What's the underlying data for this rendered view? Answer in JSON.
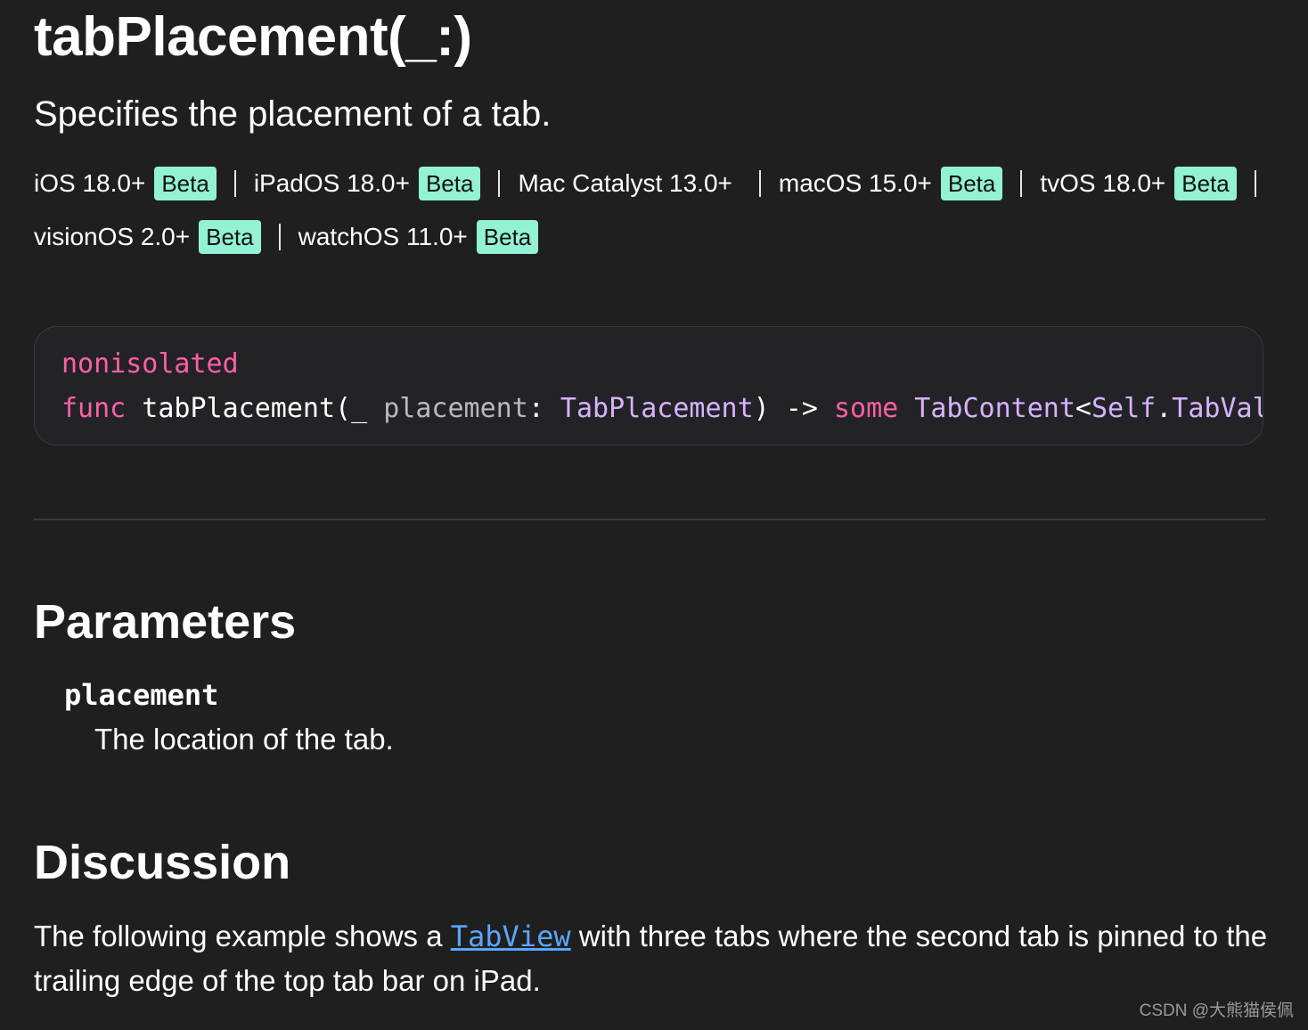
{
  "page": {
    "title": "tabPlacement(_:)",
    "abstract": "Specifies the placement of a tab."
  },
  "platforms": [
    {
      "name": "iOS 18.0+",
      "badge": "Beta"
    },
    {
      "name": "iPadOS 18.0+",
      "badge": "Beta"
    },
    {
      "name": "Mac Catalyst 13.0+",
      "badge": ""
    },
    {
      "name": "macOS 15.0+",
      "badge": "Beta"
    },
    {
      "name": "tvOS 18.0+",
      "badge": "Beta"
    },
    {
      "name": "visionOS 2.0+",
      "badge": "Beta"
    },
    {
      "name": "watchOS 11.0+",
      "badge": "Beta"
    }
  ],
  "declaration": {
    "line1": {
      "attribute": "nonisolated"
    },
    "line2": {
      "keyword_func": "func",
      "name_open": " tabPlacement(_ ",
      "param_label": "placement",
      "colon": ": ",
      "param_type": "TabPlacement",
      "arrow": ") -> ",
      "keyword_some": "some",
      "space": " ",
      "return_type": "TabContent",
      "lt": "<",
      "self_type": "Self",
      "dot": ".",
      "assoc_type": "TabVal"
    }
  },
  "parameters": {
    "heading": "Parameters",
    "items": [
      {
        "name": "placement",
        "description": "The location of the tab."
      }
    ]
  },
  "discussion": {
    "heading": "Discussion",
    "text_before": "The following example shows a ",
    "link_text": "TabView",
    "text_after": " with three tabs where the second tab is pinned to the trailing edge of the top tab bar on iPad."
  },
  "watermark": "CSDN @大熊猫侯佩",
  "colors": {
    "background": "#1f1f1f",
    "beta_badge": "#93f2d4",
    "keyword": "#ff5fa6",
    "type": "#d6b3ff",
    "link": "#58a6ff"
  }
}
